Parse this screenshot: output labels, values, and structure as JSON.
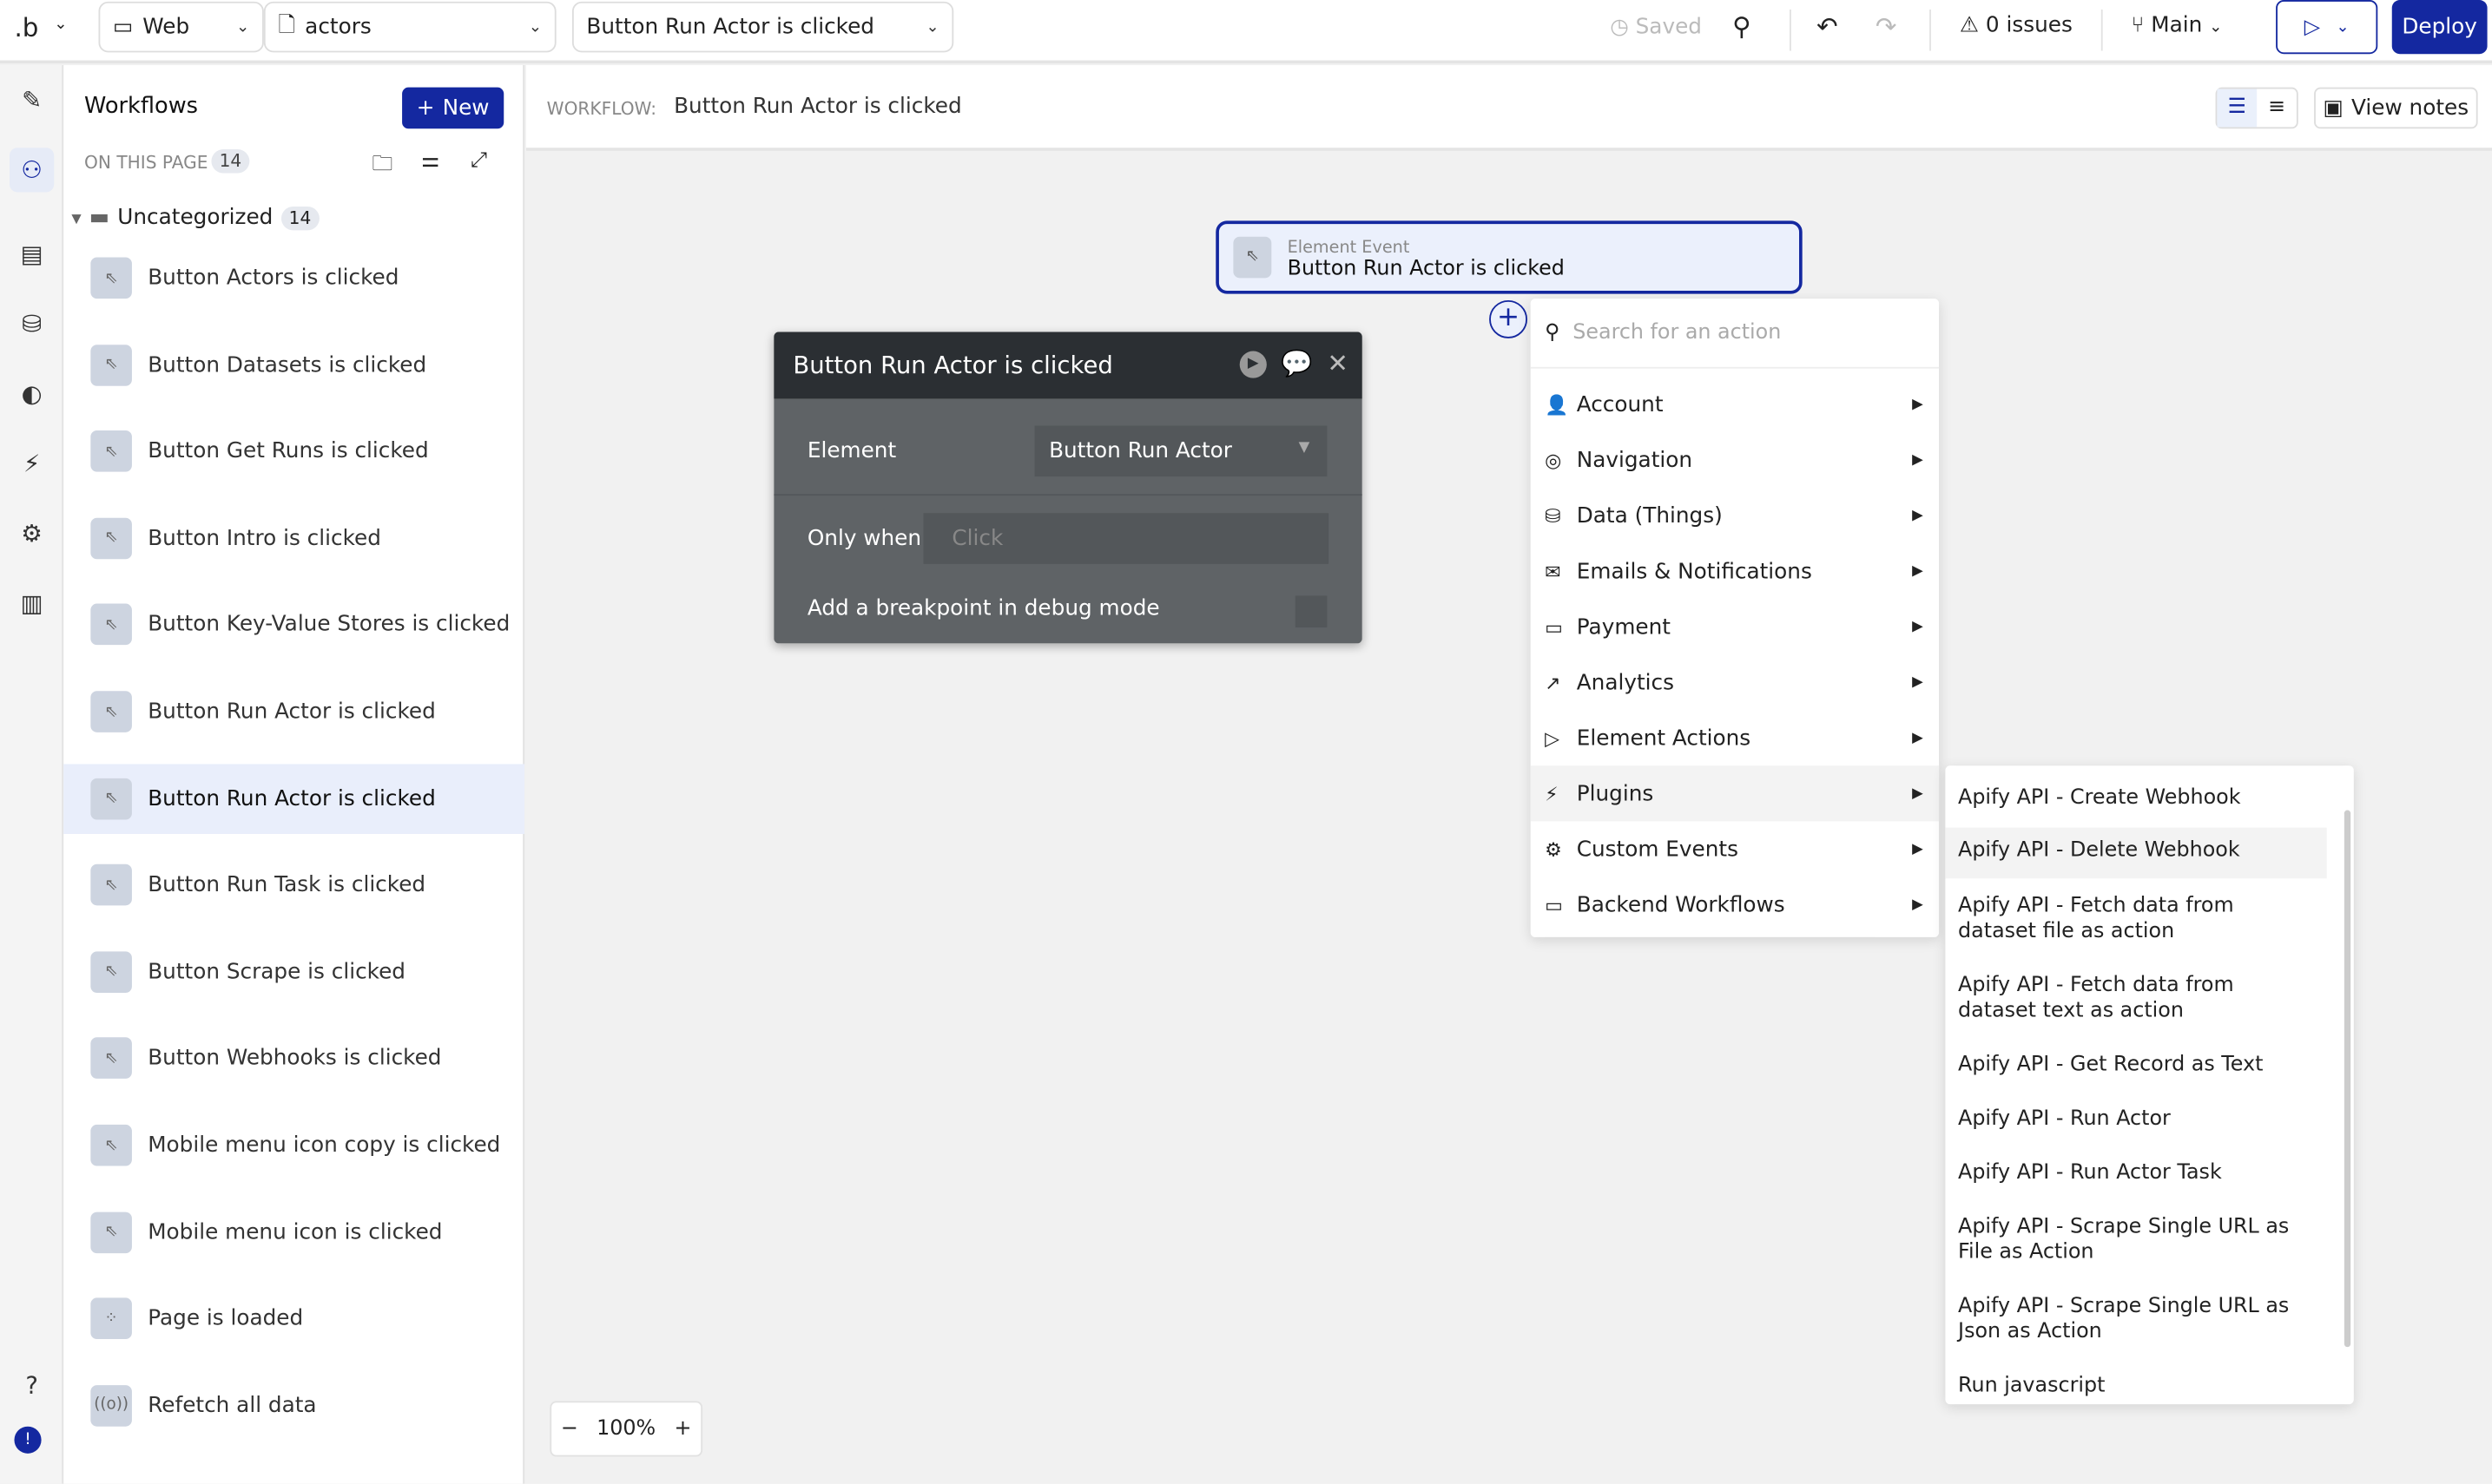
{
  "topbar": {
    "logo": ".b",
    "platform": "Web",
    "page": "actors",
    "workflow_select": "Button Run Actor is clicked",
    "saved": "Saved",
    "issues": "0 issues",
    "branch": "Main",
    "deploy": "Deploy"
  },
  "sidebar": {
    "title": "Workflows",
    "new_label": "New",
    "on_this_page": "ON THIS PAGE",
    "count": "14",
    "folder": "Uncategorized",
    "folder_count": "14",
    "items": [
      {
        "label": "Button Actors is clicked",
        "icon": "cursor-click-icon"
      },
      {
        "label": "Button Datasets is clicked",
        "icon": "cursor-click-icon"
      },
      {
        "label": "Button Get Runs is clicked",
        "icon": "cursor-click-icon"
      },
      {
        "label": "Button Intro is clicked",
        "icon": "cursor-click-icon"
      },
      {
        "label": "Button Key-Value Stores is clicked",
        "icon": "cursor-click-icon"
      },
      {
        "label": "Button Run Actor is clicked",
        "icon": "cursor-click-icon"
      },
      {
        "label": "Button Run Actor is clicked",
        "icon": "cursor-click-icon",
        "selected": true
      },
      {
        "label": "Button Run Task is clicked",
        "icon": "cursor-click-icon"
      },
      {
        "label": "Button Scrape is clicked",
        "icon": "cursor-click-icon"
      },
      {
        "label": "Button Webhooks is clicked",
        "icon": "cursor-click-icon"
      },
      {
        "label": "Mobile menu icon copy is clicked",
        "icon": "cursor-click-icon"
      },
      {
        "label": "Mobile menu icon is clicked",
        "icon": "cursor-click-icon"
      },
      {
        "label": "Page is loaded",
        "icon": "loader-icon"
      },
      {
        "label": "Refetch all data",
        "icon": "broadcast-icon"
      }
    ]
  },
  "canvas": {
    "workflow_label": "WORKFLOW:",
    "workflow_name": "Button Run Actor is clicked",
    "view_notes": "View notes",
    "zoom": "100%",
    "event_card": {
      "type": "Element Event",
      "title": "Button Run Actor is clicked"
    },
    "props": {
      "title": "Button Run Actor is clicked",
      "element_label": "Element",
      "element_value": "Button Run Actor",
      "only_when_label": "Only when",
      "only_when_placeholder": "Click",
      "breakpoint_label": "Add a breakpoint in debug mode"
    },
    "action_menu": {
      "search_placeholder": "Search for an action",
      "items": [
        "Account",
        "Navigation",
        "Data (Things)",
        "Emails & Notifications",
        "Payment",
        "Analytics",
        "Element Actions",
        "Plugins",
        "Custom Events",
        "Backend Workflows"
      ]
    },
    "plugins_submenu": [
      "Apify API - Create Webhook",
      "Apify API - Delete Webhook",
      "Apify API - Fetch data from dataset file as action",
      "Apify API - Fetch data from dataset text as action",
      "Apify API - Get Record as Text",
      "Apify API - Run Actor",
      "Apify API - Run Actor Task",
      "Apify API - Scrape Single URL as File as Action",
      "Apify API - Scrape Single URL as Json as Action",
      "Run javascript"
    ]
  },
  "colors": {
    "brand": "#1428a0",
    "selected_bg": "#e9eefb"
  }
}
